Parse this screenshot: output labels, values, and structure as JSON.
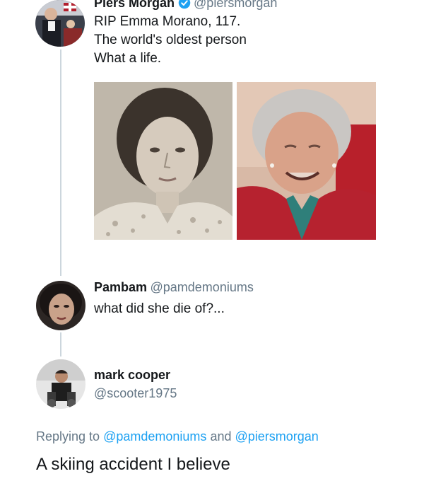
{
  "tweet1": {
    "name": "Piers Morgan",
    "handle": "@piersmorgan",
    "lines": [
      "RIP Emma Morano, 117.",
      "The world's oldest person",
      "What a life."
    ],
    "verified": true
  },
  "reply1": {
    "name": "Pambam",
    "handle": "@pamdemoniums",
    "text": "what did she die of?..."
  },
  "reply2": {
    "name": "mark cooper",
    "handle": "@scooter1975",
    "replying_prefix": "Replying to",
    "replying_user1": "@pamdemoniums",
    "replying_and": "and",
    "replying_user2": "@piersmorgan",
    "text": "A skiing accident I believe"
  },
  "colors": {
    "link": "#1da1f2",
    "handle": "#657786",
    "verified": "#1da1f2",
    "thread_line": "#ccd6dd"
  }
}
